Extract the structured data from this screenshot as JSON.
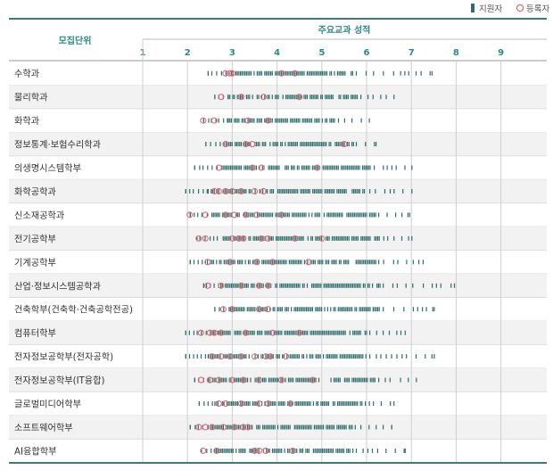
{
  "legend": {
    "applicant_label": "지원자",
    "registrant_label": "등록자",
    "applicant_color": "#2f6e6b",
    "registrant_color": "#e06a78"
  },
  "header": {
    "unit_label": "모집단위",
    "grade_label": "주요교과 성적"
  },
  "colors": {
    "rule": "#3b7b78",
    "header_text": "#2a8a86",
    "row_alt": "#f2f2f2",
    "grid": "#cfcfcf",
    "label_text": "#333333"
  },
  "chart_data": {
    "type": "scatter",
    "title": "",
    "xlabel": "주요교과 성적",
    "ylabel": "모집단위",
    "xlim": [
      1,
      9
    ],
    "ticks": [
      "1",
      "2",
      "3",
      "4",
      "5",
      "6",
      "7",
      "8",
      "9"
    ],
    "grid": true,
    "legend_position": "top-right",
    "categories": [
      {
        "unit": "수학과",
        "applicant_min": 2.45,
        "applicant_max": 7.45,
        "dense": [
          2.9,
          5.7
        ],
        "registrants": [
          2.85,
          2.95,
          3.0,
          4.1,
          4.4
        ]
      },
      {
        "unit": "물리학과",
        "applicant_min": 2.6,
        "applicant_max": 6.6,
        "dense": [
          2.9,
          5.8
        ],
        "registrants": [
          2.75,
          3.2,
          3.7,
          4.5
        ]
      },
      {
        "unit": "화학과",
        "applicant_min": 2.35,
        "applicant_max": 6.05,
        "dense": [
          2.9,
          5.3
        ],
        "registrants": [
          2.35,
          2.6,
          3.35,
          3.8
        ]
      },
      {
        "unit": "정보통계·보험수리학과",
        "applicant_min": 2.4,
        "applicant_max": 6.2,
        "dense": [
          2.85,
          5.7
        ],
        "registrants": [
          2.85,
          3.3,
          3.45,
          5.5
        ]
      },
      {
        "unit": "의생명시스템학부",
        "applicant_min": 2.15,
        "applicant_max": 7.0,
        "dense": [
          2.75,
          6.1
        ],
        "registrants": [
          2.7,
          3.45,
          3.65,
          4.9
        ]
      },
      {
        "unit": "화학공학과",
        "applicant_min": 1.95,
        "applicant_max": 7.0,
        "dense": [
          2.45,
          6.0
        ],
        "registrants": [
          2.6,
          2.7,
          2.85,
          3.0,
          3.2,
          3.5,
          3.7
        ]
      },
      {
        "unit": "신소재공학과",
        "applicant_min": 2.05,
        "applicant_max": 6.95,
        "dense": [
          2.5,
          6.2
        ],
        "registrants": [
          2.05,
          2.4,
          2.85,
          3.05,
          3.3,
          3.55,
          4.1
        ]
      },
      {
        "unit": "전기공학부",
        "applicant_min": 2.2,
        "applicant_max": 7.0,
        "dense": [
          2.75,
          6.4
        ],
        "registrants": [
          2.25,
          2.4,
          3.0,
          3.15,
          3.25,
          3.65,
          3.8,
          4.4,
          5.0
        ]
      },
      {
        "unit": "기계공학부",
        "applicant_min": 2.05,
        "applicant_max": 7.25,
        "dense": [
          2.4,
          6.2
        ],
        "registrants": [
          2.45,
          2.95,
          3.55,
          3.9,
          4.7
        ]
      },
      {
        "unit": "산업·정보시스템공학과",
        "applicant_min": 2.35,
        "applicant_max": 7.95,
        "dense": [
          2.7,
          6.3
        ],
        "registrants": [
          2.45,
          2.75,
          3.2,
          3.6,
          3.8
        ]
      },
      {
        "unit": "건축학부(건축학·건축공학전공)",
        "applicant_min": 2.6,
        "applicant_max": 7.5,
        "dense": [
          2.85,
          6.3
        ],
        "registrants": [
          2.8,
          3.0,
          3.6,
          3.8
        ]
      },
      {
        "unit": "컴퓨터학부",
        "applicant_min": 1.95,
        "applicant_max": 6.85,
        "dense": [
          2.5,
          6.0
        ],
        "registrants": [
          2.3,
          2.5,
          2.6,
          2.75,
          3.3,
          3.9,
          4.5
        ]
      },
      {
        "unit": "전자정보공학부(전자공학)",
        "applicant_min": 1.95,
        "applicant_max": 7.5,
        "dense": [
          2.45,
          6.0
        ],
        "registrants": [
          2.55,
          2.75,
          2.95,
          3.2,
          3.5,
          3.75,
          3.85,
          4.2
        ]
      },
      {
        "unit": "전자정보공학부(IT융합)",
        "applicant_min": 2.15,
        "applicant_max": 7.1,
        "dense": [
          2.45,
          6.2
        ],
        "registrants": [
          2.3,
          2.5,
          2.7,
          3.0,
          3.25,
          3.6,
          4.1,
          4.8
        ]
      },
      {
        "unit": "글로벌미디어학부",
        "applicant_min": 2.25,
        "applicant_max": 6.6,
        "dense": [
          2.6,
          5.9
        ],
        "registrants": [
          2.7,
          2.85,
          3.2,
          3.6,
          3.8,
          4.3
        ]
      },
      {
        "unit": "소프트웨어학부",
        "applicant_min": 2.05,
        "applicant_max": 6.55,
        "dense": [
          2.45,
          5.8
        ],
        "registrants": [
          2.25,
          2.4,
          2.55,
          2.8,
          3.05,
          3.25,
          3.35
        ]
      },
      {
        "unit": "AI융합학부",
        "applicant_min": 2.3,
        "applicant_max": 6.85,
        "dense": [
          2.6,
          5.7
        ],
        "registrants": [
          2.35,
          2.65,
          3.5,
          3.6,
          3.75,
          4.35
        ]
      }
    ]
  }
}
